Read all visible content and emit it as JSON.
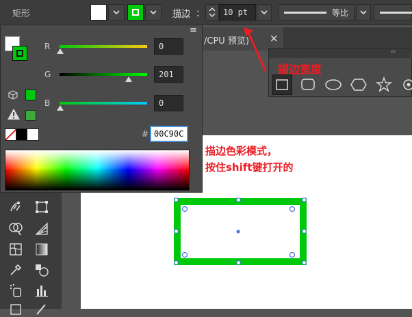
{
  "control_bar": {
    "tool_name": "矩形",
    "fill_color": "#ffffff",
    "stroke_color": "#00c90c",
    "stroke_label": "描边",
    "stroke_colon": "：",
    "stroke_width": "10 pt",
    "profile_label": "等比",
    "dropdown_glyph": "⌄"
  },
  "document_tab": {
    "label": "/CPU 预览)",
    "close_glyph": "×"
  },
  "color_panel": {
    "menu_glyph": "≡",
    "channels": [
      {
        "label": "R",
        "value": "0",
        "level": 0
      },
      {
        "label": "G",
        "value": "201",
        "level": 0.788
      },
      {
        "label": "B",
        "value": "0",
        "level": 0
      }
    ],
    "hash_label": "#",
    "hex_value": "00C90C",
    "gamut_color_1": "#00c90c",
    "gamut_color_2": "#3caa3c"
  },
  "shapes_panel": {
    "grip_glyph": "‹‹"
  },
  "annotations": {
    "stroke_width_note": "描边宽度",
    "color_mode_note_line1": "描边色彩模式，",
    "color_mode_note_line2": "按住shift键打开的",
    "color": "#ee1c24"
  },
  "canvas": {
    "shape_stroke_color": "#00c90c",
    "selection_color": "#4a6fe3"
  }
}
